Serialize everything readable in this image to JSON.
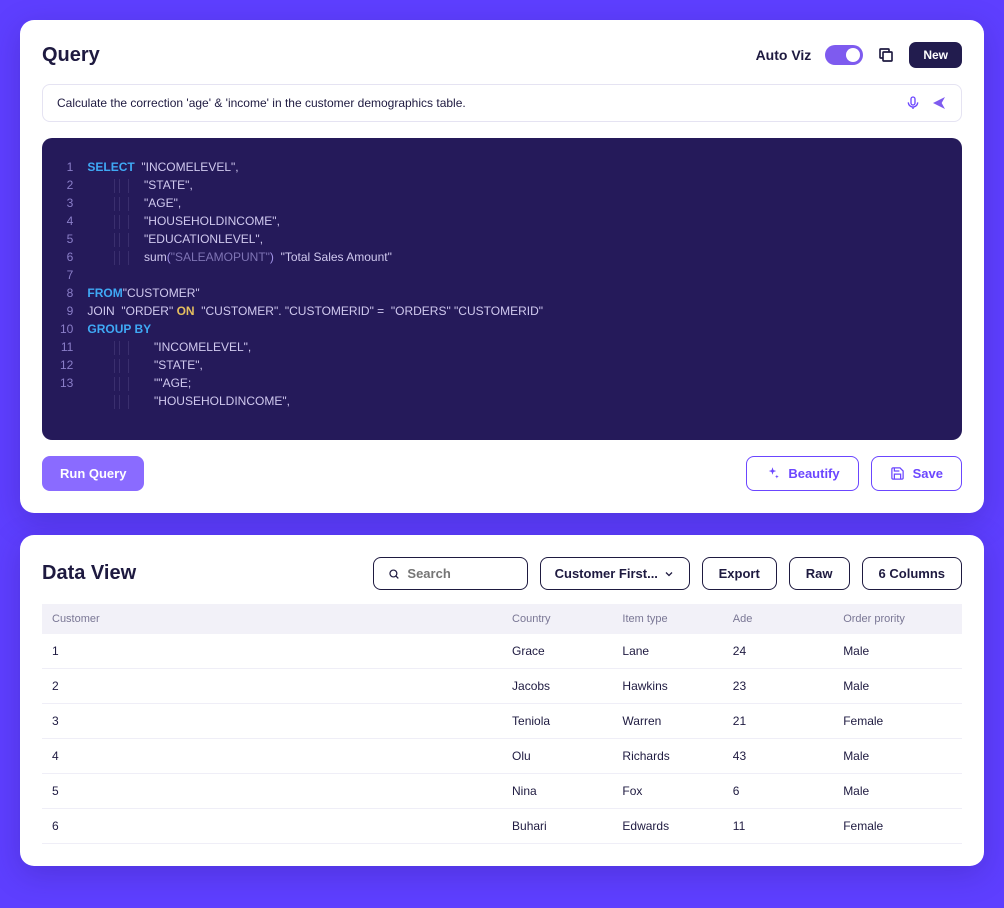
{
  "query": {
    "title": "Query",
    "autoviz_label": "Auto Viz",
    "new_label": "New",
    "prompt_value": "Calculate the correction 'age' & 'income' in the customer demographics table.",
    "code": {
      "line_numbers": [
        "1",
        "2",
        "3",
        "4",
        "5",
        "6",
        "7",
        "8",
        "9",
        "10",
        "11",
        "12",
        "13"
      ],
      "kw_select": "SELECT",
      "kw_from": "FROM",
      "kw_on": "ON",
      "kw_groupby": "GROUP BY",
      "sel1": "\"INCOMELEVEL\",",
      "sel2": "\"STATE\",",
      "sel3": "\"AGE\",",
      "sel4": "\"HOUSEHOLDINCOME\",",
      "sel5": "\"EDUCATIONLEVEL\",",
      "sel6a": "sum",
      "sel6b": "(",
      "sel6c": "\"SALEAMOPUNT\"",
      "sel6d": ")",
      "sel6e": "  \"Total Sales Amount\"",
      "from_ident": "\"CUSTOMER\"",
      "join_text": "JOIN  \"ORDER\" ",
      "on_text": "  \"CUSTOMER\". \"CUSTOMERID\" =  \"ORDERS\" \"CUSTOMERID\"",
      "grp1": "\"INCOMELEVEL\",",
      "grp2": "\"STATE\",",
      "grp3": "\"\"AGE;",
      "grp4": "\"HOUSEHOLDINCOME\","
    },
    "run_label": "Run Query",
    "beautify_label": "Beautify",
    "save_label": "Save"
  },
  "dataview": {
    "title": "Data View",
    "search_placeholder": "Search",
    "dropdown_label": "Customer First...",
    "export_label": "Export",
    "raw_label": "Raw",
    "columns_label": "6 Columns",
    "headers": [
      "Customer",
      "Country",
      "Item type",
      "Ade",
      "Order prority"
    ],
    "rows": [
      {
        "c0": "1",
        "c1": "Grace",
        "c2": "Lane",
        "c3": "24",
        "c4": "Male"
      },
      {
        "c0": "2",
        "c1": "Jacobs",
        "c2": "Hawkins",
        "c3": "23",
        "c4": "Male"
      },
      {
        "c0": "3",
        "c1": "Teniola",
        "c2": "Warren",
        "c3": "21",
        "c4": "Female"
      },
      {
        "c0": "4",
        "c1": "Olu",
        "c2": "Richards",
        "c3": "43",
        "c4": "Male"
      },
      {
        "c0": "5",
        "c1": "Nina",
        "c2": "Fox",
        "c3": "6",
        "c4": "Male"
      },
      {
        "c0": "6",
        "c1": "Buhari",
        "c2": "Edwards",
        "c3": "11",
        "c4": "Female"
      }
    ]
  }
}
